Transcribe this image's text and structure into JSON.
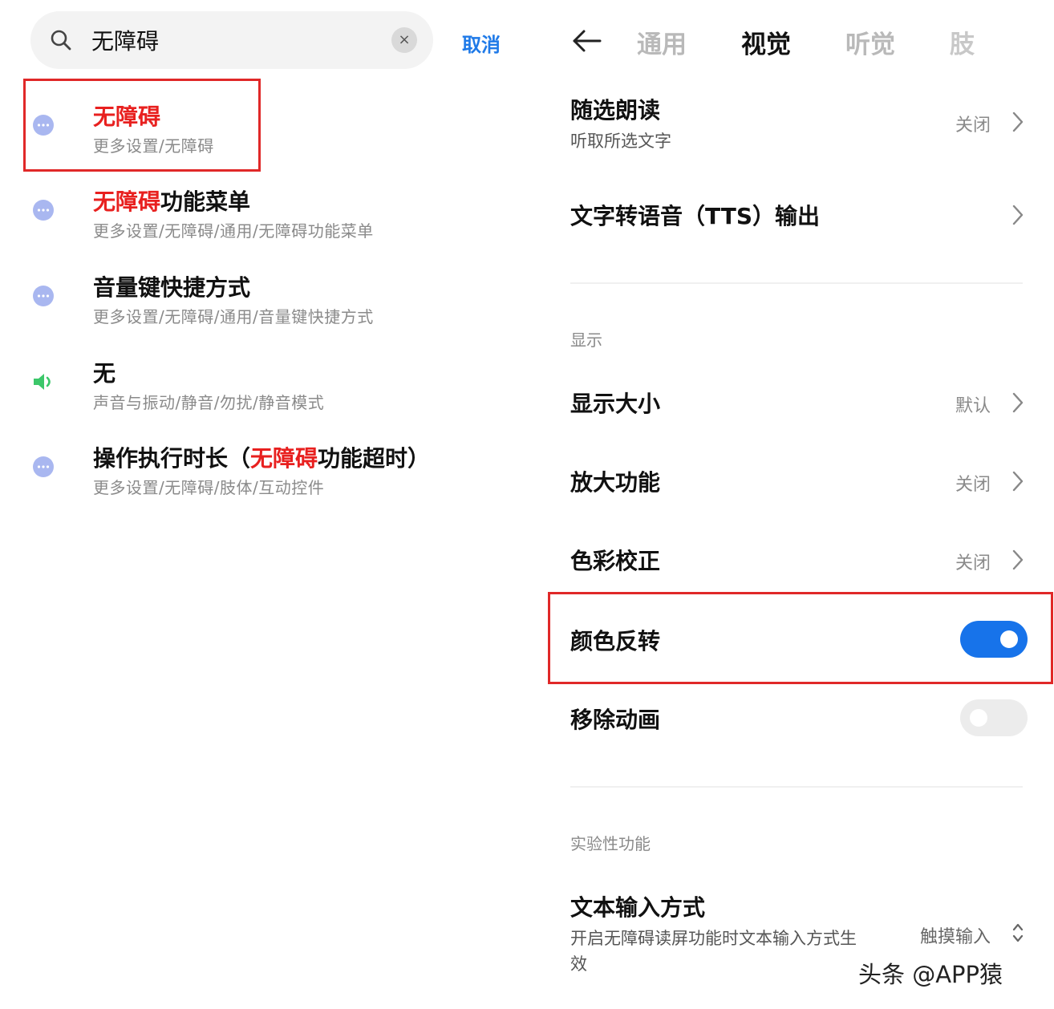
{
  "search": {
    "value": "无障碍",
    "clear_label": "×",
    "cancel_label": "取消"
  },
  "results": [
    {
      "parts": [
        {
          "text": "无障碍",
          "hl": true
        }
      ],
      "path": "更多设置/无障碍",
      "icon": "more-dots-icon"
    },
    {
      "parts": [
        {
          "text": "无障碍",
          "hl": true
        },
        {
          "text": "功能菜单",
          "hl": false
        }
      ],
      "path": "更多设置/无障碍/通用/无障碍功能菜单",
      "icon": "more-dots-icon"
    },
    {
      "parts": [
        {
          "text": "音量键快捷方式",
          "hl": false
        }
      ],
      "path": "更多设置/无障碍/通用/音量键快捷方式",
      "icon": "more-dots-icon"
    },
    {
      "parts": [
        {
          "text": "无",
          "hl": false
        }
      ],
      "path": "声音与振动/静音/勿扰/静音模式",
      "icon": "speaker-icon"
    },
    {
      "parts": [
        {
          "text": "操作执行时长（",
          "hl": false
        },
        {
          "text": "无障碍",
          "hl": true
        },
        {
          "text": "功能超时）",
          "hl": false
        }
      ],
      "path": "更多设置/无障碍/肢体/互动控件",
      "icon": "more-dots-icon"
    }
  ],
  "tabs": [
    {
      "label": "通用",
      "state": "inactive"
    },
    {
      "label": "视觉",
      "state": "active"
    },
    {
      "label": "听觉",
      "state": "inactive"
    },
    {
      "label": "肢",
      "state": "faded"
    }
  ],
  "settings": {
    "select_to_speak": {
      "title": "随选朗读",
      "subtitle": "听取所选文字",
      "value": "关闭"
    },
    "tts_output": {
      "title": "文字转语音（TTS）输出"
    },
    "display_section": "显示",
    "display_size": {
      "title": "显示大小",
      "value": "默认"
    },
    "magnification": {
      "title": "放大功能",
      "value": "关闭"
    },
    "color_correction": {
      "title": "色彩校正",
      "value": "关闭"
    },
    "color_inversion": {
      "title": "颜色反转",
      "on": true
    },
    "remove_animations": {
      "title": "移除动画",
      "on": false
    },
    "experimental_section": "实验性功能",
    "text_input": {
      "title": "文本输入方式",
      "subtitle_line1": "开启无障碍读屏功能时文本输入方式生",
      "subtitle_line2": "效",
      "value": "触摸输入"
    }
  },
  "watermark": "头条 @APP猿",
  "colors": {
    "accent": "#1773ea",
    "highlight": "#e8201f",
    "annotation_box": "#e02828",
    "dots_icon": "#a9b7f0",
    "speaker_icon": "#3cc76a"
  }
}
